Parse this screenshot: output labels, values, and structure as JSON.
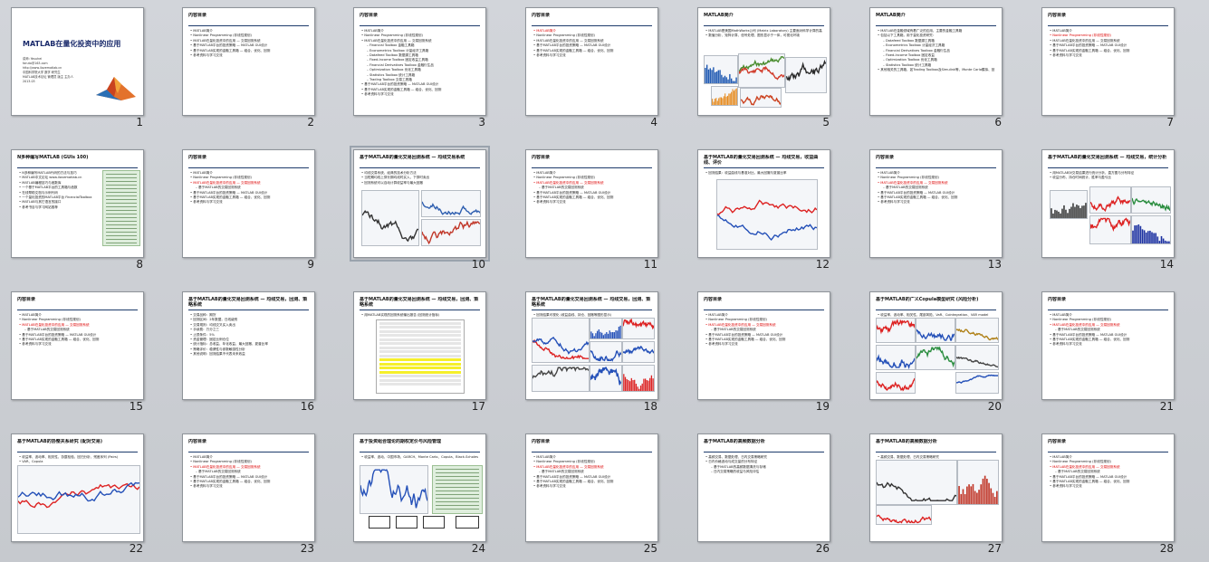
{
  "slides": [
    {
      "number": "1",
      "kind": "title",
      "title": "MATLAB在量化投资中的应用",
      "lines": [
        "讲师: Yasuhei",
        "faruto@163.com",
        "http://www.ilovematlab.cn",
        "中国科学院大学 数学 研究生",
        "MATLAB技术论坛 管理员 版主 主办人",
        "2013.03"
      ]
    },
    {
      "number": "2",
      "kind": "text",
      "title": "内容目录",
      "bullets": [
        {
          "t": "MATLAB简介"
        },
        {
          "t": "Nonlinear Programming (非线性规划)"
        },
        {
          "t": "MATLAB在量化投资中的应用 — 交易回测系统"
        },
        {
          "t": "基于MATLAB平台的投资策略 — MATLAB GUI设计"
        },
        {
          "t": "基于MATLAB实现的金融工具箱 — 组合、优化、回测"
        },
        {
          "t": "参考资料与学习交流"
        }
      ]
    },
    {
      "number": "3",
      "kind": "text",
      "title": "内容目录",
      "bullets": [
        {
          "t": "MATLAB简介"
        },
        {
          "t": "Nonlinear Programming (非线性规划)"
        },
        {
          "t": "MATLAB在量化投资中的应用 — 交易回测系统"
        },
        {
          "t": "Financial Toolbox 金融工具箱",
          "c": "sub"
        },
        {
          "t": "Econometrics Toolbox 计量经济工具箱",
          "c": "sub"
        },
        {
          "t": "Datafeed Toolbox 数据源工具箱",
          "c": "sub"
        },
        {
          "t": "Fixed-Income Toolbox 固定收益工具箱",
          "c": "sub"
        },
        {
          "t": "Financial Derivatives Toolbox 金融衍生品",
          "c": "sub"
        },
        {
          "t": "Optimization Toolbox 优化工具箱",
          "c": "sub"
        },
        {
          "t": "Statistics Toolbox 统计工具箱",
          "c": "sub"
        },
        {
          "t": "Trading Toolbox 交易工具箱",
          "c": "sub"
        },
        {
          "t": "基于MATLAB平台的投资策略 — MATLAB GUI设计"
        },
        {
          "t": "基于MATLAB实现的金融工具箱 — 组合、优化、回测"
        },
        {
          "t": "参考资料与学习交流"
        }
      ]
    },
    {
      "number": "4",
      "kind": "text",
      "title": "内容目录",
      "bullets": [
        {
          "t": "MATLAB简介",
          "c": "red"
        },
        {
          "t": "Nonlinear Programming (非线性规划)"
        },
        {
          "t": "MATLAB在量化投资中的应用 — 交易回测系统"
        },
        {
          "t": "基于MATLAB平台的投资策略 — MATLAB GUI设计"
        },
        {
          "t": "基于MATLAB实现的金融工具箱 — 组合、优化、回测"
        },
        {
          "t": "参考资料与学习交流"
        }
      ]
    },
    {
      "number": "5",
      "kind": "figure",
      "title": "MATLAB简介",
      "bullets": [
        {
          "t": "MATLAB是美国MathWorks公司 (Matrix Laboratory) 主要面对科学计算的高级技术计算语言"
        },
        {
          "t": "数值分析、矩阵计算、信号处理、图形显示于一体，可视化环境"
        }
      ],
      "figure": "collage"
    },
    {
      "number": "6",
      "kind": "text",
      "title": "MATLAB简介",
      "bullets": [
        {
          "t": "MATLAB在金融领域有着广泛的应用，主要的金融工具箱"
        },
        {
          "t": "包括以下工具箱，用于量化投资研究:"
        },
        {
          "t": "Datafeed Toolbox 数据源工具箱",
          "c": "sub"
        },
        {
          "t": "Econometrics Toolbox 计量经济工具箱",
          "c": "sub"
        },
        {
          "t": "Financial Derivatives Toolbox 金融衍生品",
          "c": "sub"
        },
        {
          "t": "Fixed-Income Toolbox 固定收益",
          "c": "sub"
        },
        {
          "t": "Optimization Toolbox 优化工具箱",
          "c": "sub"
        },
        {
          "t": "Statistics Toolbox 统计工具箱",
          "c": "sub"
        },
        {
          "t": "其他相关的工具箱，如Trading Toolbox及Simulink等，Monte Carlo模拟、回测"
        }
      ]
    },
    {
      "number": "7",
      "kind": "text",
      "title": "内容目录",
      "bullets": [
        {
          "t": "MATLAB简介"
        },
        {
          "t": "Nonlinear Programming (非线性规划)",
          "c": "red"
        },
        {
          "t": "MATLAB在量化投资中的应用 — 交易回测系统"
        },
        {
          "t": "基于MATLAB平台的投资策略 — MATLAB GUI设计"
        },
        {
          "t": "基于MATLAB实现的金融工具箱 — 组合、优化、回测"
        },
        {
          "t": "参考资料与学习交流"
        }
      ]
    },
    {
      "number": "8",
      "kind": "figure",
      "title": "N多种编写MATLAB (GUIs 100)",
      "bullets": [
        {
          "t": "N多种编写MATLAB代码的方法与技巧"
        },
        {
          "t": "MATLAB中文论坛 www.ilovematlab.cn"
        },
        {
          "t": "MATLAB编程技巧与函数库"
        },
        {
          "t": "一个基于MATLAB平台的工具箱与函数"
        },
        {
          "t": "在线帮助文档与示例代码"
        },
        {
          "t": "一个量化投资的MATLAB平台 FinancialToolbox"
        },
        {
          "t": "MATLAB与其它语言的接口"
        },
        {
          "t": "参考书目与学习网站推荐"
        }
      ],
      "figure": "list-green"
    },
    {
      "number": "9",
      "kind": "text",
      "title": "内容目录",
      "bullets": [
        {
          "t": "MATLAB简介"
        },
        {
          "t": "Nonlinear Programming (非线性规划)"
        },
        {
          "t": "MATLAB在量化投资中的应用 — 交易回测系统",
          "c": "red"
        },
        {
          "t": "基于MATLAB的交易回测系统",
          "c": "sub"
        },
        {
          "t": "基于MATLAB平台的投资策略 — MATLAB GUI设计"
        },
        {
          "t": "基于MATLAB实现的金融工具箱 — 组合、优化、回测"
        },
        {
          "t": "参考资料与学习交流"
        }
      ]
    },
    {
      "number": "10",
      "kind": "figure",
      "title": "基于MATLAB的量化交易回测系统 — 均线交易系统",
      "bullets": [
        {
          "t": "均线交易系统，经典的技术分析方法"
        },
        {
          "t": "当短期均线上穿长期均线时买入，下穿时卖出"
        },
        {
          "t": "回测系统可以自动计算收益率与最大回撤"
        }
      ],
      "figure": "two-charts"
    },
    {
      "number": "11",
      "kind": "text",
      "title": "内容目录",
      "bullets": [
        {
          "t": "MATLAB简介"
        },
        {
          "t": "Nonlinear Programming (非线性规划)"
        },
        {
          "t": "MATLAB在量化投资中的应用 — 交易回测系统",
          "c": "red"
        },
        {
          "t": "基于MATLAB的交易回测系统",
          "c": "sub"
        },
        {
          "t": "基于MATLAB平台的投资策略 — MATLAB GUI设计"
        },
        {
          "t": "基于MATLAB实现的金融工具箱 — 组合、优化、回测"
        },
        {
          "t": "参考资料与学习交流"
        }
      ]
    },
    {
      "number": "12",
      "kind": "figure",
      "title": "基于MATLAB的量化交易回测系统 — 均线交易，收益曲线、评价",
      "bullets": [
        {
          "t": "回测结果：收益曲线与基准对比，最大回撤与夏普比率"
        }
      ],
      "figure": "big-line"
    },
    {
      "number": "13",
      "kind": "text",
      "title": "内容目录",
      "bullets": [
        {
          "t": "MATLAB简介"
        },
        {
          "t": "Nonlinear Programming (非线性规划)"
        },
        {
          "t": "MATLAB在量化投资中的应用 — 交易回测系统",
          "c": "red"
        },
        {
          "t": "基于MATLAB的交易回测系统",
          "c": "sub"
        },
        {
          "t": "基于MATLAB平台的投资策略 — MATLAB GUI设计"
        },
        {
          "t": "基于MATLAB实现的金融工具箱 — 组合、优化、回测"
        },
        {
          "t": "参考资料与学习交流"
        }
      ]
    },
    {
      "number": "14",
      "kind": "figure",
      "title": "基于MATLAB的量化交易回测系统 — 均线交易，统计分析",
      "bullets": [
        {
          "t": "用MATLAB对交易结果进行统计分析，直方图与分布特征"
        },
        {
          "t": "收益分布、持仓时间统计、胜率与盈亏比"
        }
      ],
      "figure": "stats"
    },
    {
      "number": "15",
      "kind": "text",
      "title": "内容目录",
      "bullets": [
        {
          "t": "MATLAB简介"
        },
        {
          "t": "Nonlinear Programming (非线性规划)"
        },
        {
          "t": "MATLAB在量化投资中的应用 — 交易回测系统",
          "c": "red"
        },
        {
          "t": "基于MATLAB的交易回测系统",
          "c": "sub"
        },
        {
          "t": "基于MATLAB平台的投资策略 — MATLAB GUI设计"
        },
        {
          "t": "基于MATLAB实现的金融工具箱 — 组合、优化、回测"
        },
        {
          "t": "参考资料与学习交流"
        }
      ]
    },
    {
      "number": "16",
      "kind": "text",
      "title": "基于MATLAB的量化交易回测系统 — 均线交易，回测、策略系统",
      "bullets": [
        {
          "t": "交易品种：期货"
        },
        {
          "t": "回测区间：2年数据，日线级别"
        },
        {
          "t": "交易规则：均线交叉买入卖出"
        },
        {
          "t": "手续费：万分之三"
        },
        {
          "t": "止损条件：5%"
        },
        {
          "t": "资金管理：固定比例仓位"
        },
        {
          "t": "统计指标：总收益、年化收益、最大回撤、夏普比率"
        },
        {
          "t": "策略评价：稳健性与参数敏感性分析"
        },
        {
          "t": "其他说明：回测结果不代表未来收益"
        }
      ]
    },
    {
      "number": "17",
      "kind": "figure",
      "title": "基于MATLAB的量化交易回测系统 — 均线交易，回测、策略系统",
      "bullets": [
        {
          "t": "用MATLAB实现的回测系统输出报告 (回测统计指标)"
        }
      ],
      "figure": "table"
    },
    {
      "number": "18",
      "kind": "figure",
      "title": "基于MATLAB的量化交易回测系统 — 均线交易，回测、策略系统",
      "bullets": [
        {
          "t": "回测结果可视化 (收益曲线、持仓、回撤等图形显示)"
        }
      ],
      "figure": "multi-charts"
    },
    {
      "number": "19",
      "kind": "text",
      "title": "内容目录",
      "bullets": [
        {
          "t": "MATLAB简介"
        },
        {
          "t": "Nonlinear Programming (非线性规划)"
        },
        {
          "t": "MATLAB在量化投资中的应用 — 交易回测系统",
          "c": "red"
        },
        {
          "t": "基于MATLAB的交易回测系统",
          "c": "sub"
        },
        {
          "t": "基于MATLAB平台的投资策略 — MATLAB GUI设计"
        },
        {
          "t": "基于MATLAB实现的金融工具箱 — 组合、优化、回测"
        },
        {
          "t": "参考资料与学习交流"
        }
      ]
    },
    {
      "number": "20",
      "kind": "figure",
      "title": "基于MATLAB的广义Copula模型研究 (风险分析)",
      "bullets": [
        {
          "t": "收益率、波动率、相关性、尾部风险、VaR、Cointegration、VAR model"
        }
      ],
      "figure": "grid-charts"
    },
    {
      "number": "21",
      "kind": "text",
      "title": "内容目录",
      "bullets": [
        {
          "t": "MATLAB简介"
        },
        {
          "t": "Nonlinear Programming (非线性规划)"
        },
        {
          "t": "MATLAB在量化投资中的应用 — 交易回测系统",
          "c": "red"
        },
        {
          "t": "基于MATLAB的交易回测系统",
          "c": "sub"
        },
        {
          "t": "基于MATLAB平台的投资策略 — MATLAB GUI设计"
        },
        {
          "t": "基于MATLAB实现的金融工具箱 — 组合、优化、回测"
        },
        {
          "t": "参考资料与学习交流"
        }
      ]
    },
    {
      "number": "22",
      "kind": "figure",
      "title": "基于MATLAB的协整关系研究 (配对交易)",
      "bullets": [
        {
          "t": "收益率、波动率、相关性、协整检验、回归分析、残差序列 (Pairs)"
        },
        {
          "t": "VAR、Copula"
        }
      ],
      "figure": "pair-line"
    },
    {
      "number": "23",
      "kind": "text",
      "title": "内容目录",
      "bullets": [
        {
          "t": "MATLAB简介"
        },
        {
          "t": "Nonlinear Programming (非线性规划)"
        },
        {
          "t": "MATLAB在量化投资中的应用 — 交易回测系统",
          "c": "red"
        },
        {
          "t": "基于MATLAB的交易回测系统",
          "c": "sub"
        },
        {
          "t": "基于MATLAB平台的投资策略 — MATLAB GUI设计"
        },
        {
          "t": "基于MATLAB实现的金融工具箱 — 组合、优化、回测"
        },
        {
          "t": "参考资料与学习交流"
        }
      ]
    },
    {
      "number": "24",
      "kind": "figure",
      "title": "基于投资组合理论的期权定价与风险管理",
      "bullets": [
        {
          "t": "收益率、波动、中国市场、GARCH、Monte Carlo、Copula、Black-Scholes 模型"
        }
      ],
      "figure": "flow"
    },
    {
      "number": "25",
      "kind": "text",
      "title": "内容目录",
      "bullets": [
        {
          "t": "MATLAB简介"
        },
        {
          "t": "Nonlinear Programming (非线性规划)"
        },
        {
          "t": "MATLAB在量化投资中的应用 — 交易回测系统",
          "c": "red"
        },
        {
          "t": "基于MATLAB的交易回测系统",
          "c": "sub"
        },
        {
          "t": "基于MATLAB平台的投资策略 — MATLAB GUI设计"
        },
        {
          "t": "基于MATLAB实现的金融工具箱 — 组合、优化、回测"
        },
        {
          "t": "参考资料与学习交流"
        }
      ]
    },
    {
      "number": "26",
      "kind": "text",
      "title": "基于MATLAB的高频数据分析",
      "bullets": [
        {
          "t": "高频交易、数据处理、日内交易策略研究"
        },
        {
          "t": "日内价格波动与成交量的分布特征"
        },
        {
          "t": "基于MATLAB的高频数据清洗与存储",
          "c": "sub"
        },
        {
          "t": "日内交易策略的收益与风险评估",
          "c": "sub"
        }
      ]
    },
    {
      "number": "27",
      "kind": "figure",
      "title": "基于MATLAB的高频数据分析",
      "bullets": [
        {
          "t": "高频交易、数据处理、日内交易策略研究"
        }
      ],
      "figure": "hf"
    },
    {
      "number": "28",
      "kind": "text",
      "title": "内容目录",
      "bullets": [
        {
          "t": "MATLAB简介"
        },
        {
          "t": "Nonlinear Programming (非线性规划)"
        },
        {
          "t": "MATLAB在量化投资中的应用 — 交易回测系统",
          "c": "red"
        },
        {
          "t": "基于MATLAB的交易回测系统",
          "c": "sub"
        },
        {
          "t": "基于MATLAB平台的投资策略 — MATLAB GUI设计"
        },
        {
          "t": "基于MATLAB实现的金融工具箱 — 组合、优化、回测"
        },
        {
          "t": "参考资料与学习交流"
        }
      ]
    }
  ],
  "selected_slide": "10",
  "footer_text": "Slide 1 of 28"
}
